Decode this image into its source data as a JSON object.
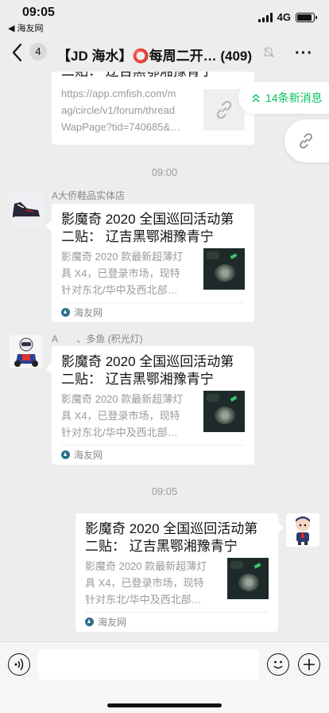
{
  "status_bar": {
    "time": "09:05",
    "back_app": "◀ 海友网",
    "network": "4G",
    "battery_level": 0.9
  },
  "header": {
    "unread_count": "4",
    "title": "【JD 海水】⭕每周二开…",
    "member_count": "(409)",
    "more_icon": "ellipsis-icon",
    "mute_icon": "mute-bell-icon"
  },
  "floating": {
    "new_messages": "14条新消息"
  },
  "messages": [
    {
      "type": "link-card-partial",
      "title_tail": "二贴： 辽吉黑鄂湘豫青宁",
      "url_lines": [
        "https://app.cmfish.com/m",
        "ag/circle/v1/forum/thread",
        "WapPage?tid=740685&…"
      ]
    },
    {
      "type": "time",
      "text": "09:00"
    },
    {
      "type": "link-card",
      "sender": "A大侨鞋品实体店",
      "title_lines": [
        "影魔奇 2020 全国巡回活动第",
        "二贴： 辽吉黑鄂湘豫青宁"
      ],
      "desc_lines": [
        "影魔奇 2020 款最新超薄灯",
        "具 X4，已登录市场，现特",
        "针对东北/华中及西北部…"
      ],
      "source": "海友网"
    },
    {
      "type": "link-card",
      "sender": "A　　、多鱼 (积光灯)",
      "title_lines": [
        "影魔奇 2020 全国巡回活动第",
        "二贴： 辽吉黑鄂湘豫青宁"
      ],
      "desc_lines": [
        "影魔奇 2020 款最新超薄灯",
        "具 X4，已登录市场，现特",
        "针对东北/华中及西北部…"
      ],
      "source": "海友网"
    },
    {
      "type": "time",
      "text": "09:05"
    },
    {
      "type": "link-card-self",
      "title_lines": [
        "影魔奇 2020 全国巡回活动第",
        "二贴： 辽吉黑鄂湘豫青宁"
      ],
      "desc_lines": [
        "影魔奇 2020 款最新超薄灯",
        "具 X4，已登录市场，现特",
        "针对东北/华中及西北部…"
      ],
      "source": "海友网"
    }
  ],
  "input_bar": {
    "placeholder": "",
    "voice_icon": "voice-icon",
    "emoji_icon": "emoji-icon",
    "plus_icon": "plus-icon"
  },
  "colors": {
    "accent_green": "#07c160",
    "chat_bg": "#ededed"
  }
}
